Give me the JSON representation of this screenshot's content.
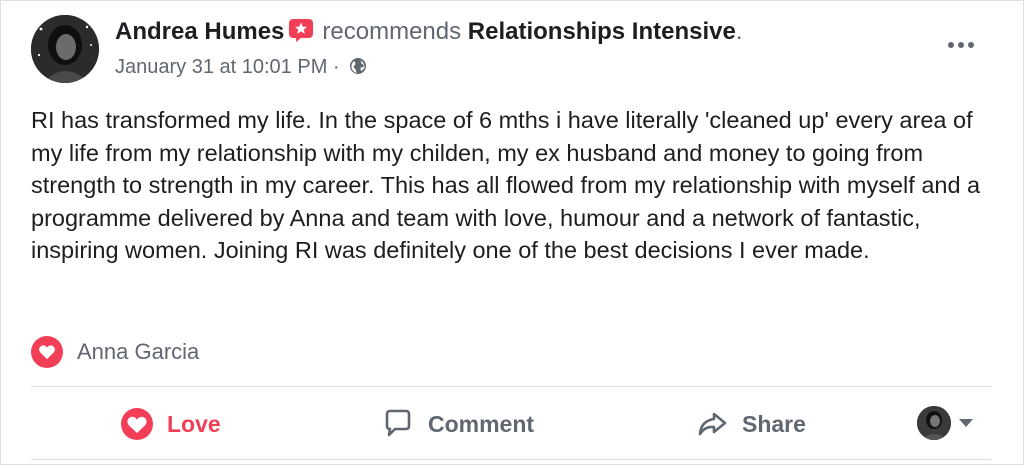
{
  "post": {
    "author": "Andrea Humes",
    "verb": "recommends",
    "page": "Relationships Intensive",
    "page_suffix": ".",
    "timestamp": "January 31 at 10:01 PM",
    "meta_separator": "·",
    "privacy_icon": "globe-icon",
    "badge_icon": "recommendation-star-icon",
    "body": "RI has transformed my life.  In the space of 6 mths i have literally 'cleaned up' every area of my life from my relationship with my childen, my ex husband and money to going from strength to strength in my career.  This has all flowed from my relationship with myself and a programme delivered by Anna and team with love, humour and a network of fantastic, inspiring women.  Joining RI was definitely one of the best decisions I ever made."
  },
  "reactions": {
    "icon": "love-reaction-icon",
    "names": "Anna Garcia"
  },
  "actions": {
    "love_label": "Love",
    "comment_label": "Comment",
    "share_label": "Share"
  },
  "colors": {
    "love": "#f33e58",
    "secondary_text": "#606770",
    "primary_text": "#1c1e21",
    "divider": "#dadde1"
  }
}
